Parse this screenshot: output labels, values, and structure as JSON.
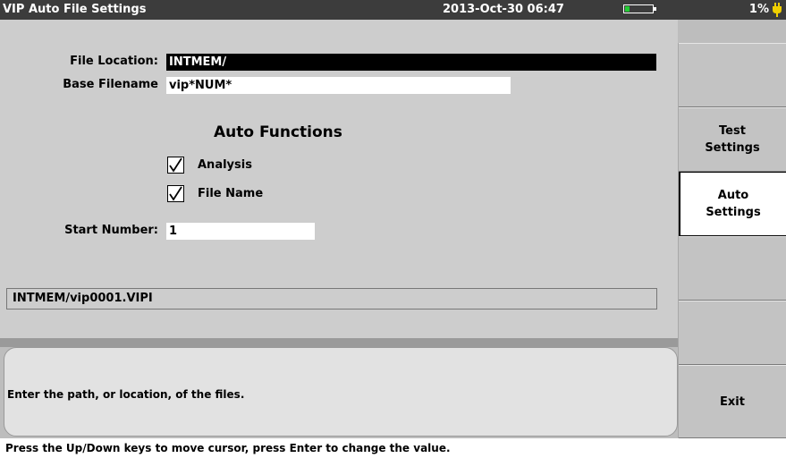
{
  "titlebar": {
    "title": "VIP Auto File Settings",
    "datetime": "2013-Oct-30 06:47",
    "battery_percent": "1%",
    "battery_level": 0.15,
    "battery_color": "#22cc33"
  },
  "form": {
    "file_location_label": "File Location:",
    "file_location_value": "INTMEM/",
    "base_filename_label": "Base Filename",
    "base_filename_value": "vip*NUM*",
    "auto_functions_heading": "Auto Functions",
    "analysis_label": "Analysis",
    "analysis_checked": true,
    "file_name_label": "File Name",
    "file_name_checked": true,
    "start_number_label": "Start Number:",
    "start_number_value": "1",
    "preview_path": "INTMEM/vip0001.VIPI"
  },
  "help": {
    "text": "Enter the path, or location, of the files."
  },
  "softkeys": {
    "test_settings": "Test\nSettings",
    "auto_settings": "Auto\nSettings",
    "exit": "Exit"
  },
  "statusbar": {
    "text": "Press the Up/Down keys to move cursor, press Enter to change the value."
  },
  "colors": {
    "panel": "#cdcdcd",
    "titlebar": "#3c3c3c",
    "active_field": "#000000"
  }
}
